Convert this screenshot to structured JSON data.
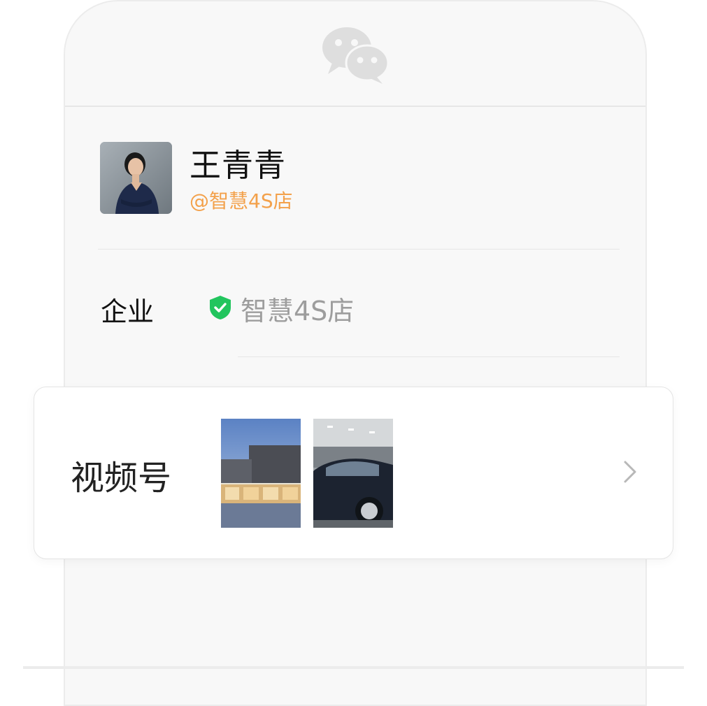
{
  "profile": {
    "name": "王青青",
    "corp_tag": "@智慧4S店"
  },
  "details": {
    "enterprise_label": "企业",
    "enterprise_name": "智慧4S店",
    "verified_icon": "shield-check-icon"
  },
  "channels": {
    "label": "视频号",
    "thumbnails": [
      "building-photo",
      "car-photo"
    ],
    "chevron_icon": "chevron-right-icon"
  },
  "colors": {
    "accent_orange": "#f3a14b",
    "verified_green": "#22c55e",
    "muted_gray": "#9d9d9d"
  }
}
